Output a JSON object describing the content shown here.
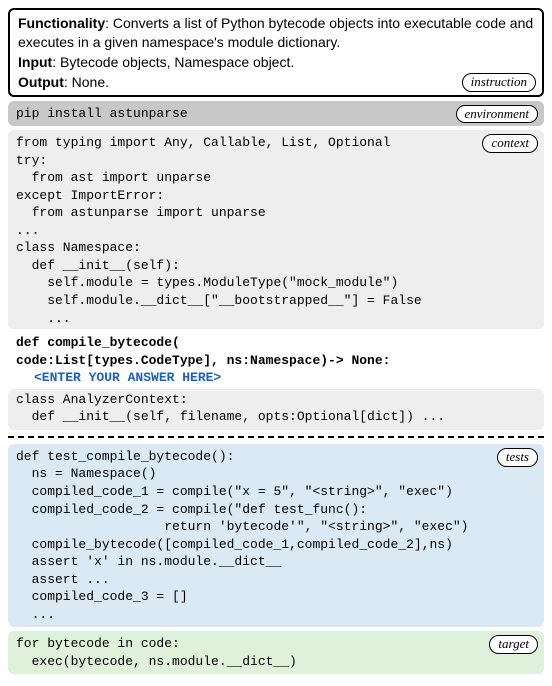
{
  "instruction": {
    "functionality_label": "Functionality",
    "functionality_text": ": Converts a list of Python bytecode objects into executable code and executes in a given namespace's module dictionary.",
    "input_label": "Input",
    "input_text": ": Bytecode objects, Namespace object.",
    "output_label": "Output",
    "output_text": ": None.",
    "tag": "instruction"
  },
  "environment": {
    "cmd": "pip install astunparse",
    "tag": "environment"
  },
  "context": {
    "tag": "context",
    "lines": [
      "from typing import Any, Callable, List, Optional",
      "try:",
      "  from ast import unparse",
      "except ImportError:",
      "  from astunparse import unparse",
      "...",
      "class Namespace:",
      "  def __init__(self):",
      "    self.module = types.ModuleType(\"mock_module\")",
      "    self.module.__dict__[\"__bootstrapped__\"] = False",
      "    ..."
    ]
  },
  "signature": {
    "line1": "def compile_bytecode(",
    "line2": "  code:List[types.CodeType], ns:Namespace)-> None:",
    "answer": "<ENTER YOUR ANSWER HERE>"
  },
  "context_after": {
    "lines": [
      "class AnalyzerContext:",
      "  def __init__(self, filename, opts:Optional[dict]) ..."
    ]
  },
  "tests": {
    "tag": "tests",
    "lines": [
      "def test_compile_bytecode():",
      "  ns = Namespace()",
      "  compiled_code_1 = compile(\"x = 5\", \"<string>\", \"exec\")",
      "  compiled_code_2 = compile(\"def test_func():",
      "                   return 'bytecode'\", \"<string>\", \"exec\")",
      "  compile_bytecode([compiled_code_1,compiled_code_2],ns)",
      "  assert 'x' in ns.module.__dict__",
      "  assert ...",
      "  compiled_code_3 = []",
      "  ..."
    ]
  },
  "target": {
    "tag": "target",
    "lines": [
      "for bytecode in code:",
      "  exec(bytecode, ns.module.__dict__)"
    ]
  }
}
